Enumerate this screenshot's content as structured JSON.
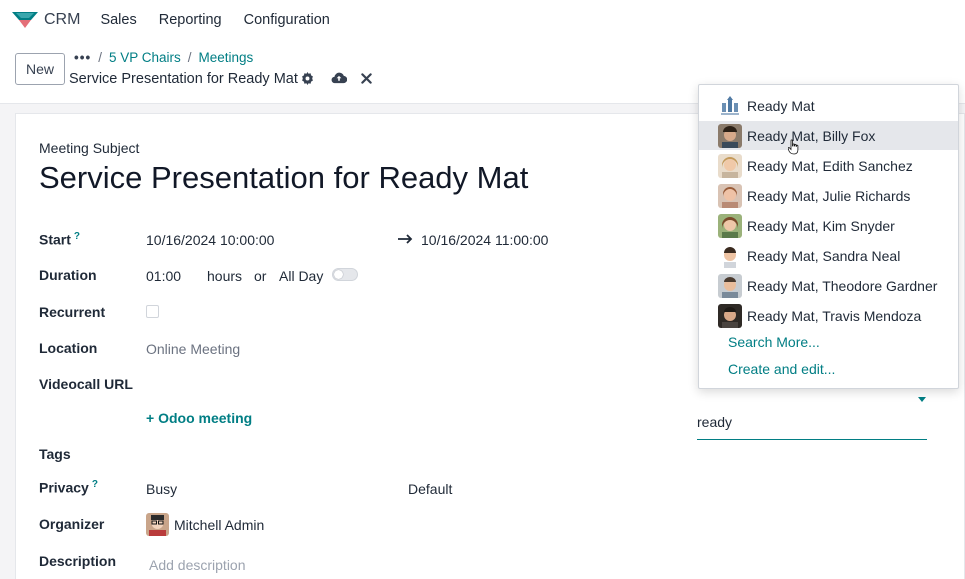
{
  "app": {
    "name": "CRM",
    "brand_color": "#017e84"
  },
  "menu": [
    "Sales",
    "Reporting",
    "Configuration"
  ],
  "control_panel": {
    "new_label": "New",
    "breadcrumb": {
      "more": "•••",
      "items": [
        "5 VP Chairs",
        "Meetings"
      ]
    },
    "record_title": "Service Presentation for Ready Mat",
    "icons": [
      "gear-icon",
      "cloud-upload-icon",
      "discard-x-icon"
    ]
  },
  "form": {
    "subject_label": "Meeting Subject",
    "subject": "Service Presentation for Ready Mat",
    "start": {
      "label": "Start",
      "help": "?",
      "from": "10/16/2024 10:00:00",
      "to": "10/16/2024 11:00:00"
    },
    "duration": {
      "label": "Duration",
      "value": "01:00",
      "unit": "hours",
      "or": "or",
      "all_day": "All Day"
    },
    "recurrent": {
      "label": "Recurrent"
    },
    "location": {
      "label": "Location",
      "value": "Online Meeting"
    },
    "videocall": {
      "label": "Videocall URL",
      "odoo_meeting": "Odoo meeting"
    },
    "tags": {
      "label": "Tags"
    },
    "privacy": {
      "label": "Privacy",
      "help": "?",
      "show_as": "Busy",
      "privacy": "Default"
    },
    "organizer": {
      "label": "Organizer",
      "value": "Mitchell Admin"
    },
    "description": {
      "label": "Description",
      "placeholder": "Add description"
    }
  },
  "attendee_search": {
    "value": "ready"
  },
  "dropdown": {
    "items": [
      "Ready Mat",
      "Ready Mat, Billy Fox",
      "Ready Mat, Edith Sanchez",
      "Ready Mat, Julie Richards",
      "Ready Mat, Kim Snyder",
      "Ready Mat, Sandra Neal",
      "Ready Mat, Theodore Gardner",
      "Ready Mat, Travis Mendoza"
    ],
    "search_more": "Search More...",
    "create_edit": "Create and edit..."
  }
}
